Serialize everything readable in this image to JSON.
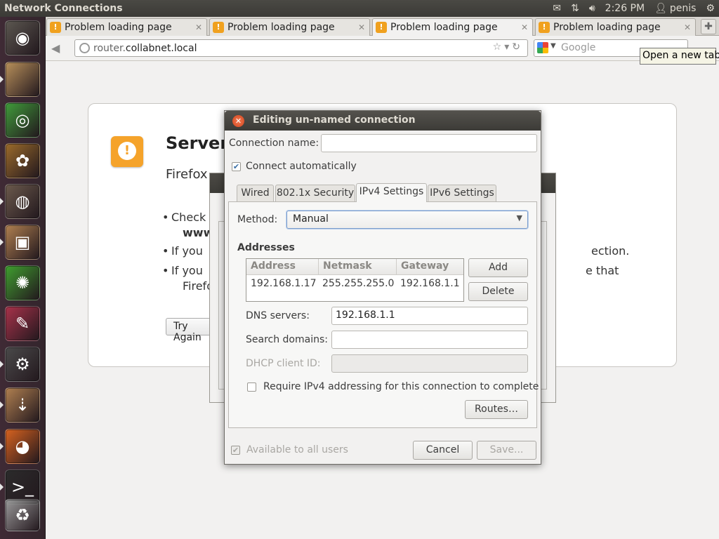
{
  "panel": {
    "app_title": "Network Connections",
    "clock": "2:26 PM",
    "user": "penis",
    "icons": [
      "mail-icon",
      "network-icon",
      "volume-icon",
      "user-icon",
      "gear-icon"
    ]
  },
  "launcher": {
    "items": [
      {
        "name": "ubuntu-dash-icon",
        "glyph": "◉",
        "color": "#5b5750"
      },
      {
        "name": "files-icon",
        "glyph": "",
        "color": "#b8905a"
      },
      {
        "name": "chrome-icon",
        "glyph": "◎",
        "color": "#3f9c3a"
      },
      {
        "name": "paint-icon",
        "glyph": "✿",
        "color": "#9b6b2a"
      },
      {
        "name": "speaker-icon",
        "glyph": "◍",
        "color": "#6b5a4c"
      },
      {
        "name": "package-icon",
        "glyph": "▣",
        "color": "#b08050"
      },
      {
        "name": "software-center-icon",
        "glyph": "✺",
        "color": "#3f9f2f"
      },
      {
        "name": "text-editor-icon",
        "glyph": "✎",
        "color": "#a8324a"
      },
      {
        "name": "system-settings-icon",
        "glyph": "⚙",
        "color": "#4a4a4a"
      },
      {
        "name": "update-manager-icon",
        "glyph": "⇣",
        "color": "#b08050"
      },
      {
        "name": "firefox-icon",
        "glyph": "◕",
        "color": "#d7621f"
      },
      {
        "name": "terminal-icon",
        "glyph": ">_",
        "color": "#2b2b2b"
      },
      {
        "name": "trash-icon",
        "glyph": "♻",
        "color": "#9a9a9a"
      }
    ]
  },
  "browser": {
    "tabs": [
      {
        "label": "Problem loading page",
        "active": false
      },
      {
        "label": "Problem loading page",
        "active": false
      },
      {
        "label": "Problem loading page",
        "active": true
      },
      {
        "label": "Problem loading page",
        "active": false
      }
    ],
    "url_host_prefix": "router.",
    "url_domain": "collabnet.local",
    "search_placeholder": "Google",
    "tooltip": "Open a new tab"
  },
  "error_page": {
    "title": "Server",
    "description": "Firefox",
    "bullet1_line1": "Check",
    "bullet1_line2": "www",
    "bullet2": "If you",
    "bullet2_tail": "ection.",
    "bullet3_line1": "If you",
    "bullet3_tail": "e that",
    "bullet3_line2": "Firefo",
    "try_again": "Try Again"
  },
  "dialog": {
    "title": "Editing un-named connection",
    "connection_name_label": "Connection name:",
    "connection_name_value": "",
    "connect_automatically_label": "Connect automatically",
    "connect_automatically": true,
    "tabs": [
      {
        "label": "Wired",
        "active": false
      },
      {
        "label": "802.1x Security",
        "active": false
      },
      {
        "label": "IPv4 Settings",
        "active": true
      },
      {
        "label": "IPv6 Settings",
        "active": false
      }
    ],
    "method_label": "Method:",
    "method_value": "Manual",
    "addresses_heading": "Addresses",
    "columns": [
      "Address",
      "Netmask",
      "Gateway"
    ],
    "rows": [
      [
        "192.168.1.17",
        "255.255.255.0",
        "192.168.1.1"
      ]
    ],
    "add_button": "Add",
    "delete_button": "Delete",
    "dns_label": "DNS servers:",
    "dns_value": "192.168.1.1",
    "search_domains_label": "Search domains:",
    "search_domains_value": "",
    "dhcp_client_id_label": "DHCP client ID:",
    "dhcp_client_id_value": "",
    "require_ipv4_label": "Require IPv4 addressing for this connection to complete",
    "require_ipv4": false,
    "routes_button": "Routes…",
    "available_all_users_label": "Available to all users",
    "available_all_users": true,
    "cancel_button": "Cancel",
    "save_button": "Save..."
  },
  "colors": {
    "panel_bg": "#3b3a36",
    "launcher_bg": "#3f2a35",
    "dialog_close": "#d2441d",
    "focus_blue": "#7a9ccc",
    "error_orange": "#f5a32b"
  }
}
